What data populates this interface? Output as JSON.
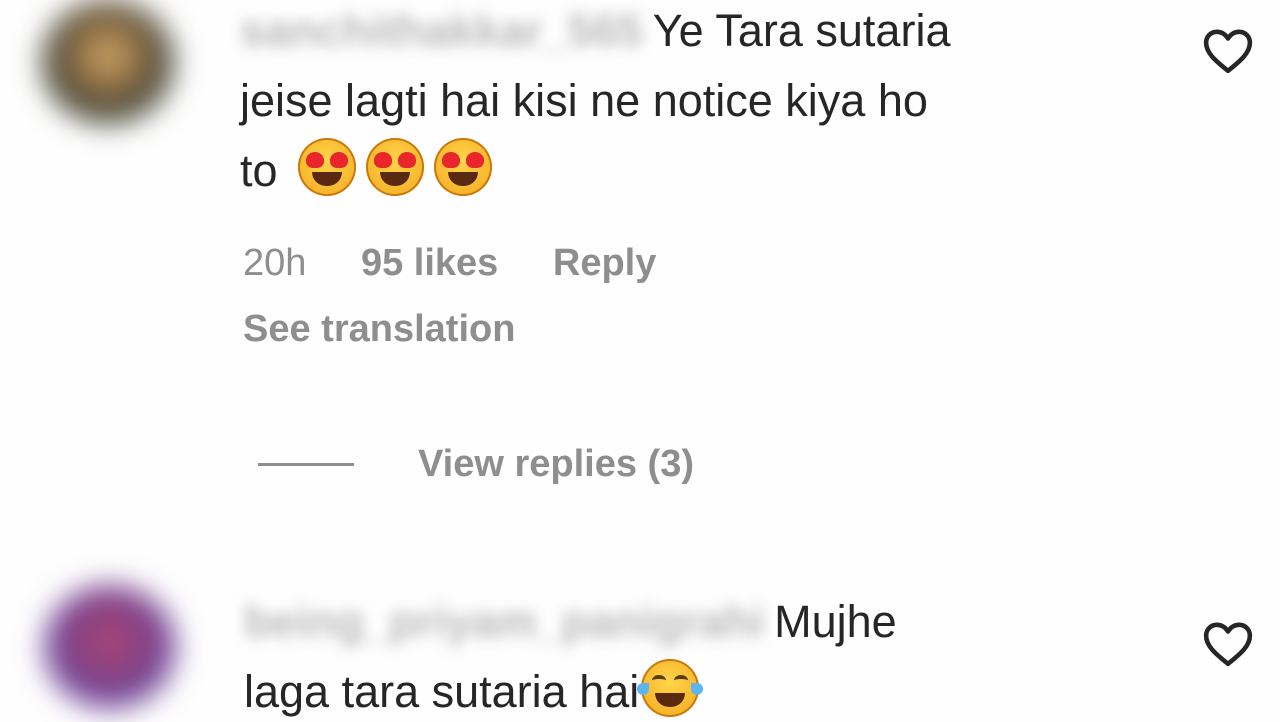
{
  "comments": [
    {
      "username": "sanchithakkar_565",
      "line1": "Ye Tara sutaria",
      "line2": "jeise lagti hai kisi ne notice kiya ho",
      "line3": "to",
      "emojis": [
        "heart-eyes-emoji",
        "heart-eyes-emoji",
        "heart-eyes-emoji"
      ],
      "time": "20h",
      "likes": "95 likes",
      "reply": "Reply",
      "see_translation": "See translation",
      "view_replies": "View replies (3)",
      "like_icon": "heart-outline-icon"
    },
    {
      "username": "being_priyam_panigrahi",
      "line1": "Mujhe",
      "line2": "laga tara sutaria hai",
      "emojis": [
        "tears-of-joy-emoji"
      ],
      "like_icon": "heart-outline-icon"
    }
  ]
}
